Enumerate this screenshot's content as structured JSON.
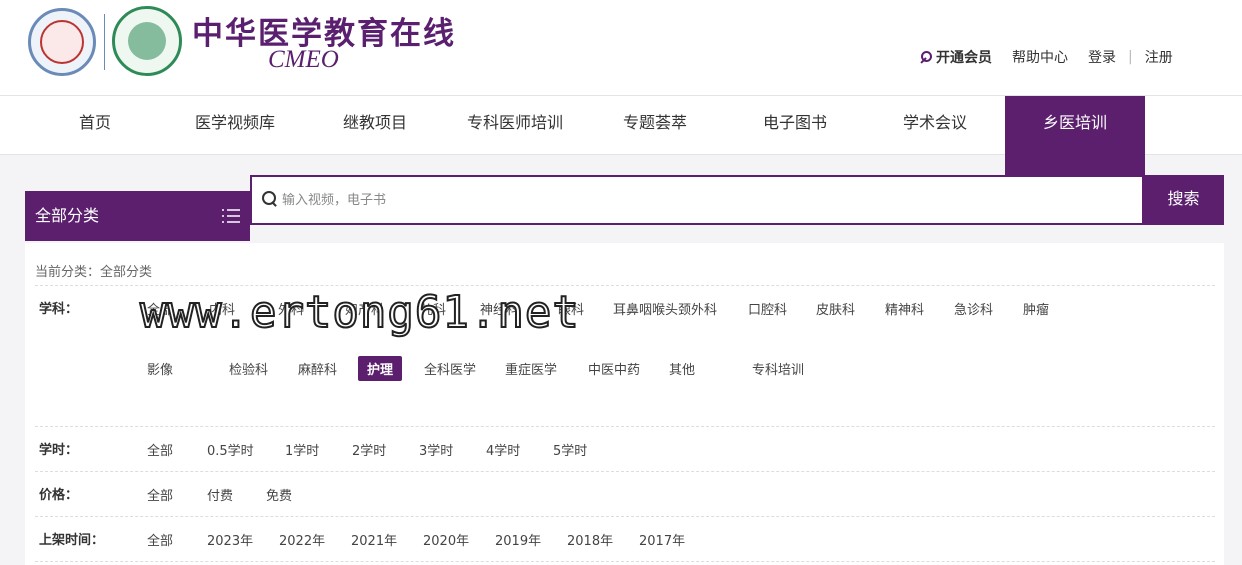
{
  "header": {
    "brand_title": "中华医学教育在线",
    "brand_sub": "CMEO",
    "vip_label": "开通会员",
    "help_label": "帮助中心",
    "login_label": "登录",
    "divider": "|",
    "register_label": "注册"
  },
  "nav": {
    "items": [
      "首页",
      "医学视频库",
      "继教项目",
      "专科医师培训",
      "专题荟萃",
      "电子图书",
      "学术会议",
      "乡医培训"
    ],
    "active_index": 7
  },
  "search": {
    "category_label": "全部分类",
    "placeholder": "输入视频，电子书",
    "button_label": "搜索"
  },
  "filters": {
    "current_label": "当前分类：全部分类",
    "subject": {
      "label": "学科：",
      "row1": [
        "全部",
        "内科",
        "外科",
        "妇产科",
        "儿科",
        "神经科",
        "眼科",
        "耳鼻咽喉头颈外科",
        "口腔科",
        "皮肤科",
        "精神科",
        "急诊科",
        "肿瘤"
      ],
      "row2": [
        "影像",
        "检验科",
        "麻醉科",
        "护理",
        "全科医学",
        "重症医学",
        "中医中药",
        "其他",
        "专科培训"
      ],
      "active": "护理"
    },
    "hours": {
      "label": "学时：",
      "options": [
        "全部",
        "0.5学时",
        "1学时",
        "2学时",
        "3学时",
        "4学时",
        "5学时"
      ]
    },
    "price": {
      "label": "价格：",
      "options": [
        "全部",
        "付费",
        "免费"
      ]
    },
    "release": {
      "label": "上架时间：",
      "options": [
        "全部",
        "2023年",
        "2022年",
        "2021年",
        "2020年",
        "2019年",
        "2018年",
        "2017年"
      ]
    }
  },
  "watermark": "www.ertong61.net",
  "colors": {
    "brand": "#5b1f6e"
  }
}
